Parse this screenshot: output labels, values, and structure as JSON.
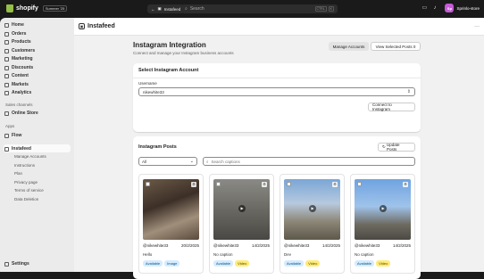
{
  "topbar": {
    "brand": "shopify",
    "edition_badge": "Summer '25",
    "app_chip": "Instafeed",
    "search_placeholder": "Search",
    "shortcut_keys": [
      "CTRL",
      "K"
    ],
    "store_initials": "Sp",
    "store_name": "Sprinlo-store"
  },
  "sidebar": {
    "items": [
      {
        "label": "Home",
        "icon": "home-icon"
      },
      {
        "label": "Orders",
        "icon": "orders-icon"
      },
      {
        "label": "Products",
        "icon": "tag-icon"
      },
      {
        "label": "Customers",
        "icon": "person-icon"
      },
      {
        "label": "Marketing",
        "icon": "target-icon"
      },
      {
        "label": "Discounts",
        "icon": "discount-icon"
      },
      {
        "label": "Content",
        "icon": "content-icon"
      },
      {
        "label": "Markets",
        "icon": "globe-icon"
      },
      {
        "label": "Analytics",
        "icon": "chart-icon"
      }
    ],
    "sales_channels_label": "Sales channels",
    "online_store": "Online Store",
    "apps_label": "Apps",
    "flow": "Flow",
    "active_app": "Instafeed",
    "app_subitems": [
      "Manage Accounts",
      "Instructions",
      "Plan",
      "Privacy page",
      "Terms of service",
      "Data Deletion"
    ],
    "settings": "Settings"
  },
  "appbar": {
    "title": "Instafeed"
  },
  "page": {
    "title": "Instagram Integration",
    "subtitle": "Connect and manage your Instagram business accounts",
    "manage_accounts_button": "Manage Accounts",
    "view_selected_button": "View Selected Posts",
    "view_selected_count": "0"
  },
  "select_account": {
    "title": "Select Instagram Account",
    "username_label": "Username",
    "username_value": "nikewhite33",
    "connect_button": "Connect to Instagram"
  },
  "posts": {
    "title": "Instagram Posts",
    "update_button": "Update Posts",
    "filter_value": "All",
    "search_placeholder": "Search captions",
    "items": [
      {
        "user": "@nikewhite33",
        "date": "20/2/2025",
        "caption": "Hello",
        "status": "Available",
        "type": "Image"
      },
      {
        "user": "@nikewhite33",
        "date": "14/2/2025",
        "caption": "No caption",
        "status": "Available",
        "type": "Video"
      },
      {
        "user": "@nikewhite33",
        "date": "14/2/2025",
        "caption": "Dev",
        "status": "Available",
        "type": "Video"
      },
      {
        "user": "@nikewhite33",
        "date": "14/2/2025",
        "caption": "No caption",
        "status": "Available",
        "type": "Video"
      }
    ]
  }
}
